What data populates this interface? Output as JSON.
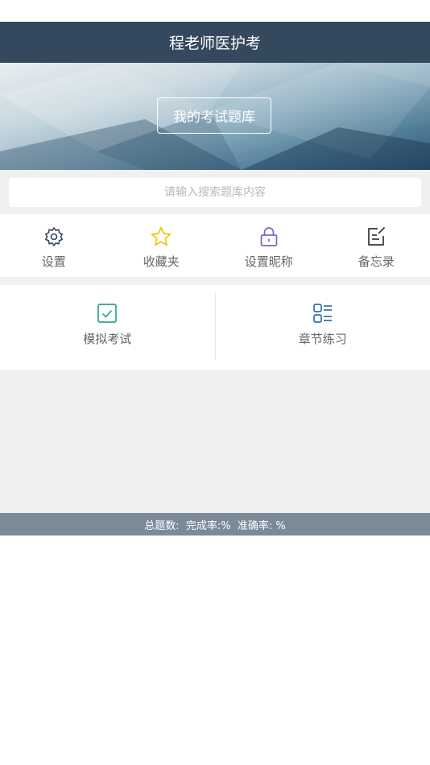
{
  "header": {
    "title": "程老师医护考"
  },
  "banner": {
    "button_label": "我的考试题库"
  },
  "search": {
    "placeholder": "请输入搜索题库内容",
    "value": ""
  },
  "toolbar": {
    "items": [
      {
        "label": "设置",
        "icon": "gear-icon",
        "color": "#34495e"
      },
      {
        "label": "收藏夹",
        "icon": "star-icon",
        "color": "#f1c40f"
      },
      {
        "label": "设置昵称",
        "icon": "lock-icon",
        "color": "#7b61c9"
      },
      {
        "label": "备忘录",
        "icon": "edit-icon",
        "color": "#333333"
      }
    ]
  },
  "modes": {
    "items": [
      {
        "label": "模拟考试",
        "icon": "checkbox-icon",
        "color": "#2aa876"
      },
      {
        "label": "章节练习",
        "icon": "list-icon",
        "color": "#2f6ea3"
      }
    ]
  },
  "stats": {
    "text": "总题数:  完成率:%  准确率: %"
  },
  "colors": {
    "header": "#34495e",
    "statbar": "#7a8a99",
    "background": "#f0f0f0"
  }
}
